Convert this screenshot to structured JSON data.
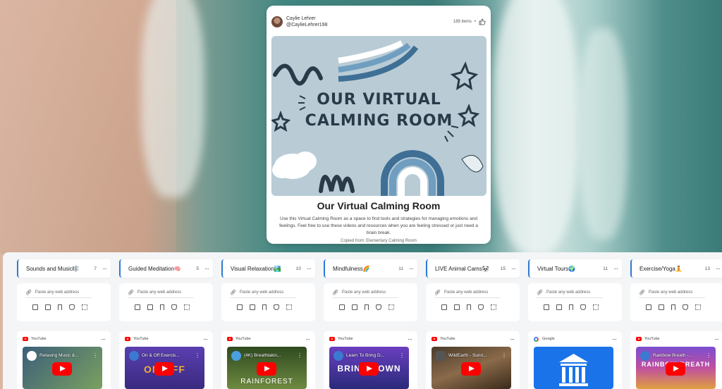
{
  "header": {
    "author_name": "Caylie Lehrer",
    "author_handle": "@CaylieLehrer198",
    "item_count": "189 items",
    "separator": "•",
    "cover_text_line1": "OUR VIRTUAL",
    "cover_text_line2": "CALMING ROOM",
    "title": "Our Virtual Calming Room",
    "description": "Use this Virtual Calming Room as a space to find tools and strategies for managing emotions and feelings. Feel free to use these videos and resources when you are feeling stressed or just need a brain break.",
    "copied_from": "Copied from: Elementary Calming Room"
  },
  "colors": {
    "accent": "#2e7ad1",
    "cover_bg": "#b9ccd6",
    "youtube_red": "#ff0000"
  },
  "add_placeholder": "Paste any web address",
  "more_label": "···",
  "columns": [
    {
      "title": "Sounds and Music🎼",
      "count": "7",
      "source": "YouTube",
      "video_title": "Relaxing Music &...",
      "thumb_big": "",
      "thumb_colors": [
        "#3b5f7a",
        "#7aa060"
      ]
    },
    {
      "title": "Guided Meditation🧠",
      "count": "5",
      "source": "YouTube",
      "video_title": "On & Off Exercis...",
      "thumb_big": "ON  OFF",
      "thumb_colors": [
        "#5a3fb0",
        "#e0a020"
      ]
    },
    {
      "title": "Visual Relaxation🏞️",
      "count": "10",
      "source": "YouTube",
      "video_title": "(4K) Breathtakin...",
      "thumb_big": "RAINFOREST",
      "thumb_colors": [
        "#2f4a20",
        "#6f8a40"
      ]
    },
    {
      "title": "Mindfulness🌈",
      "count": "11",
      "source": "YouTube",
      "video_title": "Learn To Bring D...",
      "thumb_big": "BRING DOWN",
      "thumb_colors": [
        "#6a3fc0",
        "#2a2a7a"
      ]
    },
    {
      "title": "LIVE Animal Cams🐼",
      "count": "15",
      "source": "YouTube",
      "video_title": "WildEarth - Sunri...",
      "thumb_big": "",
      "thumb_colors": [
        "#4a3b2a",
        "#8a6a4a"
      ]
    },
    {
      "title": "Virtual Tours🌍",
      "count": "11",
      "source": "Google",
      "video_title": "",
      "thumb_big": "",
      "thumb_colors": [
        "#1a73e8",
        "#1a73e8"
      ]
    },
    {
      "title": "Exercise/Yoga🧘",
      "count": "13",
      "source": "YouTube",
      "video_title": "Rainbow Breath -...",
      "thumb_big": "RAINBOW BREATH",
      "thumb_colors": [
        "#7a4fd0",
        "#e04fa0"
      ]
    }
  ]
}
